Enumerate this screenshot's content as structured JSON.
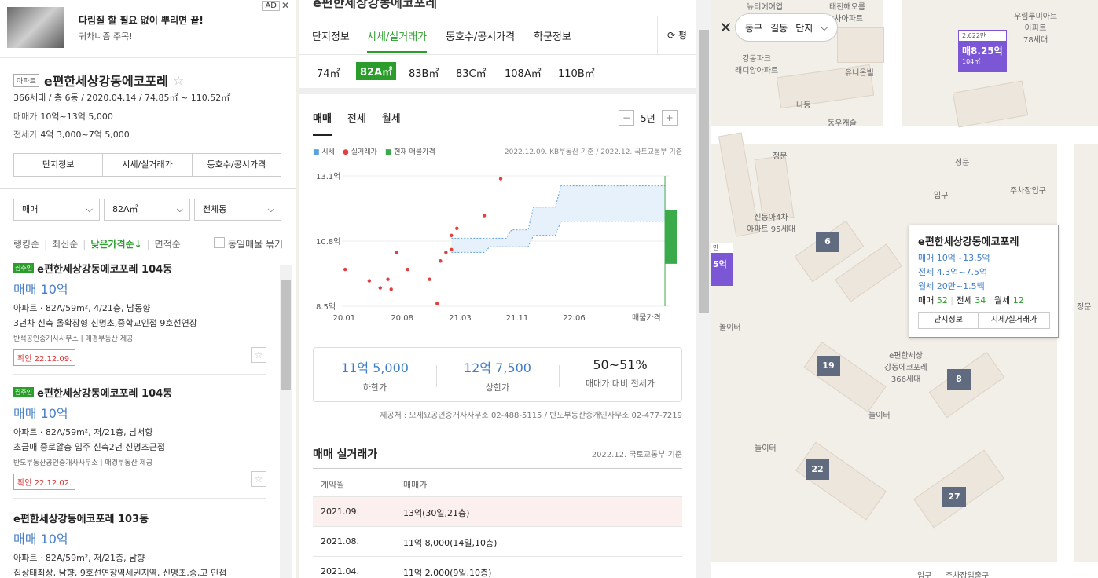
{
  "ad": {
    "badge": "AD",
    "close": "✕",
    "line1": "다림질 할 필요 없이 뿌리면 끝!",
    "line2": "귀차니즘 주목!"
  },
  "complex": {
    "tag": "아파트",
    "name": "e편한세상강동에코포레",
    "star": "☆",
    "summary": "366세대 / 총 6동 / 2020.04.14 / 74.85㎡ ~ 110.52㎡",
    "sale_label": "매매가",
    "sale_value": "10억~13억 5,000",
    "jeonse_label": "전세가",
    "jeonse_value": "4억 3,000~7억 5,000",
    "tabs": [
      "단지정보",
      "시세/실거래가",
      "동호수/공시가격"
    ]
  },
  "filters": {
    "deal": "매매",
    "area": "82A㎡",
    "dong": "전체동",
    "chev": "⌵"
  },
  "sort": {
    "items": [
      "랭킹순",
      "최신순",
      "낮은가격순↓",
      "면적순"
    ],
    "sep": "|",
    "same_check": "동일매물 묶기"
  },
  "listings": [
    {
      "badge": "집주인",
      "title": "e편한세상강동에코포레 104동",
      "price": "매매 10억",
      "detail": "아파트 · 82A/59m², 4/21층, 남동향",
      "desc": "3년차 신축 올확장형 신명초,중학교인접 9호선연장",
      "agent": "반석공인중개사사무소 | 매경부동산 제공",
      "confirm": "확인 22.12.09.",
      "fav": "☆"
    },
    {
      "badge": "집주인",
      "title": "e편한세상강동에코포레 104동",
      "price": "매매 10억",
      "detail": "아파트 · 82A/59m², 저/21층, 남서향",
      "desc": "초급매 중로알층 입주 신축2년 신명초근접",
      "agent": "반도부동산공인중개사사무소 | 매경부동산 제공",
      "confirm": "확인 22.12.02.",
      "fav": "☆"
    },
    {
      "badge": "",
      "title": "e편한세상강동에코포레 103동",
      "price": "매매 10억",
      "detail": "아파트 · 82A/59m², 저/21층, 남향",
      "desc": "집상태최상, 남향, 9호선연장역세권지역, 신명초,중,고 인접",
      "agent": "",
      "confirm": "",
      "fav": ""
    }
  ],
  "mid": {
    "top_cut": "e편한세상강동에코포레",
    "tabs": [
      "단지정보",
      "시세/실거래가",
      "동호수/공시가격",
      "학군정보"
    ],
    "refresh": "⟳ 평",
    "areas": [
      "74㎡",
      "82A㎡",
      "83B㎡",
      "83C㎡",
      "108A㎡",
      "110B㎡"
    ],
    "chart_tabs": [
      "매매",
      "전세",
      "월세"
    ],
    "period": "5년",
    "minus": "−",
    "plus": "+",
    "legend": [
      "시세",
      "실거래가",
      "현재 매물가격"
    ],
    "source": "2022.12.09. KB부동산 기준 / 2022.12. 국토교통부 기준",
    "stats": [
      {
        "value": "11억 5,000",
        "label": "하한가"
      },
      {
        "value": "12억 7,500",
        "label": "상한가"
      },
      {
        "value": "50~51%",
        "label": "매매가 대비 전세가"
      }
    ],
    "provider": "제공처 : 오세요공인중개사사무소 02-488-5115 / 반도부동산중개인사무소 02-477-7219",
    "section_title": "매매 실거래가",
    "section_src": "2022.12. 국토교통부 기준",
    "table_head": [
      "계약월",
      "매매가"
    ],
    "table_rows": [
      {
        "month": "2021.09.",
        "price": "13억(30일,21층)"
      },
      {
        "month": "2021.08.",
        "price": "11억 8,000(14일,10층)"
      },
      {
        "month": "2021.04.",
        "price": "11억 2,000(9일,10층)"
      }
    ]
  },
  "chart_data": {
    "type": "line",
    "y_ticks": [
      "13.1억",
      "10.8억",
      "8.5억"
    ],
    "ylim": [
      8.5,
      13.1
    ],
    "x_ticks": [
      "20.01",
      "20.08",
      "21.03",
      "21.11",
      "22.06",
      "매물가격"
    ],
    "series": [
      {
        "name": "시세",
        "color": "#5aa0e0",
        "upper": [
          [
            21.0,
            10.9
          ],
          [
            21.5,
            10.9
          ],
          [
            21.55,
            11.2
          ],
          [
            21.7,
            11.2
          ],
          [
            21.75,
            12.0
          ],
          [
            21.95,
            12.0
          ],
          [
            22.0,
            12.75
          ],
          [
            22.95,
            12.75
          ]
        ],
        "lower": [
          [
            21.0,
            10.4
          ],
          [
            21.3,
            10.4
          ],
          [
            21.35,
            10.6
          ],
          [
            21.7,
            10.6
          ],
          [
            21.75,
            11.0
          ],
          [
            21.95,
            11.0
          ],
          [
            22.0,
            11.5
          ],
          [
            22.95,
            11.5
          ]
        ]
      },
      {
        "name": "실거래가",
        "color": "#e04040",
        "points": [
          [
            20.03,
            9.8
          ],
          [
            20.25,
            9.4
          ],
          [
            20.35,
            9.15
          ],
          [
            20.42,
            9.45
          ],
          [
            20.45,
            9.1
          ],
          [
            20.5,
            10.4
          ],
          [
            20.6,
            9.8
          ],
          [
            20.8,
            9.45
          ],
          [
            20.87,
            8.6
          ],
          [
            20.9,
            10.1
          ],
          [
            20.95,
            10.4
          ],
          [
            21.0,
            10.5
          ],
          [
            21.05,
            11.25
          ],
          [
            21.0,
            11.0
          ],
          [
            21.3,
            11.7
          ],
          [
            21.45,
            13.0
          ]
        ]
      },
      {
        "name": "현재 매물가격",
        "color": "#3aaa4a",
        "range": [
          10.0,
          11.9
        ]
      }
    ]
  },
  "map": {
    "close": "✕",
    "breadcrumb": [
      "동구",
      "길동",
      "단지"
    ],
    "chev": "⌵",
    "labels": [
      "태천해오름\n8차아파트",
      "강동파크\n래디앙아파트",
      "유니온빌",
      "동우캐슬",
      "우림루미아트\n아파트\n78세대",
      "신동아4차\n아파트 95세대",
      "e편한세상\n강동에코포레\n366세대",
      "놀이터",
      "놀이터",
      "놀이터",
      "정문",
      "정문",
      "입구",
      "주차장입구",
      "입구",
      "주차장입출구",
      "뉴티에어업",
      "나동",
      "정문"
    ],
    "badge_purple": {
      "top": "2,622만",
      "price": "매8.25억",
      "size": "104㎡"
    },
    "edge_badge": {
      "top": "만",
      "price": "5억"
    },
    "pins": [
      "6",
      "19",
      "8",
      "22",
      "27"
    ],
    "popup": {
      "title": "e편한세상강동에코포레",
      "sale": "매매 10억~13.5억",
      "jeonse": "전세 4.3억~7.5억",
      "monthly": "월세 20만~1.5백",
      "counts_sale_label": "매매",
      "counts_sale": "52",
      "counts_jeonse_label": "전세",
      "counts_jeonse": "34",
      "counts_monthly_label": "월세",
      "counts_monthly": "12",
      "btn1": "단지정보",
      "btn2": "시세/실거래가"
    }
  }
}
